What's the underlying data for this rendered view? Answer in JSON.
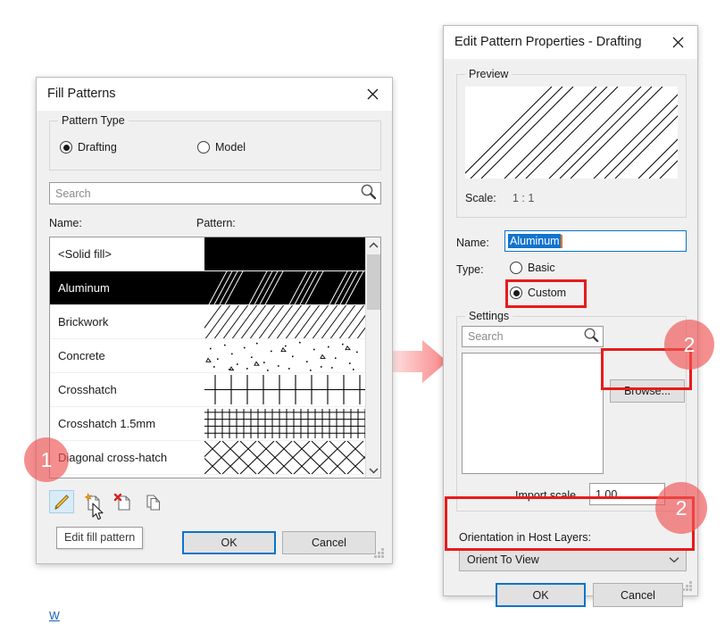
{
  "fill_patterns_dialog": {
    "title": "Fill Patterns",
    "close_icon": "close-icon",
    "pattern_type": {
      "legend": "Pattern Type",
      "options": [
        {
          "label": "Drafting",
          "selected": true
        },
        {
          "label": "Model",
          "selected": false
        }
      ]
    },
    "search": {
      "placeholder": "Search",
      "value": "",
      "icon": "magnifier-icon"
    },
    "columns": {
      "name": "Name:",
      "pattern": "Pattern:"
    },
    "rows": [
      {
        "name": "<Solid fill>",
        "pattern": "solid",
        "selected": false
      },
      {
        "name": "Aluminum",
        "pattern": "aluminum",
        "selected": true
      },
      {
        "name": "Brickwork",
        "pattern": "brickwork",
        "selected": false
      },
      {
        "name": "Concrete",
        "pattern": "concrete",
        "selected": false
      },
      {
        "name": "Crosshatch",
        "pattern": "crosshatch",
        "selected": false
      },
      {
        "name": "Crosshatch 1.5mm",
        "pattern": "crosshatch15",
        "selected": false
      },
      {
        "name": "Diagonal cross-hatch",
        "pattern": "diagonal-cross-hatch",
        "selected": false
      }
    ],
    "scrollbar": {
      "up_icon": "chevron-up-icon",
      "down_icon": "chevron-down-icon"
    },
    "toolbar": [
      {
        "name": "edit-fill-pattern",
        "icon": "pencil-icon",
        "active": true
      },
      {
        "name": "new-fill-pattern",
        "icon": "new-document-icon",
        "active": false
      },
      {
        "name": "delete-fill-pattern",
        "icon": "delete-document-icon",
        "active": false
      },
      {
        "name": "duplicate-fill-pattern",
        "icon": "duplicate-document-icon",
        "active": false
      }
    ],
    "tooltip": "Edit fill pattern",
    "help_link": "W",
    "ok": "OK",
    "cancel": "Cancel"
  },
  "edit_pattern_dialog": {
    "title": "Edit Pattern Properties - Drafting",
    "close_icon": "close-icon",
    "preview": {
      "legend": "Preview",
      "scale_label": "Scale:",
      "scale_value": "1 : 1"
    },
    "name_label": "Name:",
    "name_value": "Aluminum",
    "type_label": "Type:",
    "type_options": [
      {
        "label": "Basic",
        "selected": false
      },
      {
        "label": "Custom",
        "selected": true
      }
    ],
    "settings": {
      "legend": "Settings",
      "search": {
        "placeholder": "Search",
        "icon": "magnifier-icon"
      },
      "browse": "Browse...",
      "import_scale_label": "Import scale",
      "import_scale_value": "1.00"
    },
    "orientation_label": "Orientation in Host Layers:",
    "orientation_value": "Orient To View",
    "orientation_caret": "chevron-down-icon",
    "ok": "OK",
    "cancel": "Cancel"
  },
  "annotations": {
    "badges": [
      {
        "text": "1"
      },
      {
        "text": "2"
      },
      {
        "text": "2"
      }
    ],
    "accent_color": "#e81b1b",
    "badge_color": "#f05555",
    "arrow_color": "#fb9a9a"
  }
}
